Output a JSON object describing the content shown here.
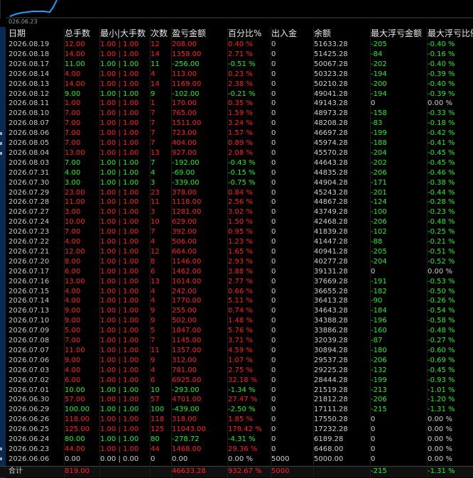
{
  "chart": {
    "date_label": "026.06.23",
    "line_color": "#1fa0ff"
  },
  "columns": [
    "日期",
    "总手数",
    "最小|大手数",
    "次数",
    "盈亏金额",
    "百分比%",
    "出入金",
    "余额",
    "最大浮亏金额",
    "最大浮亏比例"
  ],
  "rows": [
    {
      "date": "2026.08.19",
      "lots": "12.00",
      "minmax": "1.00 | 1.00",
      "count": "12",
      "pnl": "208.00",
      "pct": "0.40 %",
      "io": "0",
      "bal": "51633.28",
      "maxloss": "-205",
      "maxpct": "-0.40 %",
      "dir": "red"
    },
    {
      "date": "2026.08.18",
      "lots": "14.00",
      "minmax": "1.00 | 1.00",
      "count": "14",
      "pnl": "1358.00",
      "pct": "2.71 %",
      "io": "0",
      "bal": "51425.28",
      "maxloss": "-84",
      "maxpct": "-0.16 %",
      "dir": "red"
    },
    {
      "date": "2026.08.17",
      "lots": "11.00",
      "minmax": "1.00 | 1.00",
      "count": "11",
      "pnl": "-256.00",
      "pct": "-0.51 %",
      "io": "0",
      "bal": "50067.28",
      "maxloss": "-202",
      "maxpct": "-0.40 %",
      "dir": "green"
    },
    {
      "date": "2026.08.14",
      "lots": "4.00",
      "minmax": "1.00 | 1.00",
      "count": "4",
      "pnl": "113.00",
      "pct": "0.23 %",
      "io": "0",
      "bal": "50323.28",
      "maxloss": "-194",
      "maxpct": "-0.39 %",
      "dir": "red"
    },
    {
      "date": "2026.08.13",
      "lots": "14.00",
      "minmax": "1.00 | 1.00",
      "count": "14",
      "pnl": "1169.00",
      "pct": "2.38 %",
      "io": "0",
      "bal": "50210.28",
      "maxloss": "-200",
      "maxpct": "-0.40 %",
      "dir": "red"
    },
    {
      "date": "2026.08.12",
      "lots": "9.00",
      "minmax": "1.00 | 1.00",
      "count": "9",
      "pnl": "-102.00",
      "pct": "-0.21 %",
      "io": "0",
      "bal": "49041.28",
      "maxloss": "-194",
      "maxpct": "-0.39 %",
      "dir": "green"
    },
    {
      "date": "2026.08.11",
      "lots": "1.00",
      "minmax": "1.00 | 1.00",
      "count": "1",
      "pnl": "170.00",
      "pct": "0.35 %",
      "io": "0",
      "bal": "49143.28",
      "maxloss": "0",
      "maxpct": "0.00 %",
      "dir": "red"
    },
    {
      "date": "2026.08.10",
      "lots": "7.00",
      "minmax": "1.00 | 1.00",
      "count": "7",
      "pnl": "765.00",
      "pct": "1.59 %",
      "io": "0",
      "bal": "48973.28",
      "maxloss": "-158",
      "maxpct": "-0.33 %",
      "dir": "red"
    },
    {
      "date": "2026.08.07",
      "lots": "7.00",
      "minmax": "1.00 | 1.00",
      "count": "7",
      "pnl": "1511.00",
      "pct": "3.24 %",
      "io": "0",
      "bal": "48208.28",
      "maxloss": "-83",
      "maxpct": "-0.18 %",
      "dir": "red"
    },
    {
      "date": "2026.08.06",
      "lots": "7.00",
      "minmax": "1.00 | 1.00",
      "count": "7",
      "pnl": "723.00",
      "pct": "1.57 %",
      "io": "0",
      "bal": "46697.28",
      "maxloss": "-199",
      "maxpct": "-0.42 %",
      "dir": "red"
    },
    {
      "date": "2026.08.05",
      "lots": "7.00",
      "minmax": "1.00 | 1.00",
      "count": "7",
      "pnl": "404.00",
      "pct": "0.89 %",
      "io": "0",
      "bal": "45974.28",
      "maxloss": "-188",
      "maxpct": "-0.41 %",
      "dir": "red"
    },
    {
      "date": "2026.08.04",
      "lots": "13.00",
      "minmax": "1.00 | 1.00",
      "count": "13",
      "pnl": "927.00",
      "pct": "2.08 %",
      "io": "0",
      "bal": "45570.28",
      "maxloss": "-204",
      "maxpct": "-0.45 %",
      "dir": "red"
    },
    {
      "date": "2026.08.03",
      "lots": "7.00",
      "minmax": "1.00 | 1.00",
      "count": "7",
      "pnl": "-192.00",
      "pct": "-0.43 %",
      "io": "0",
      "bal": "44643.28",
      "maxloss": "-202",
      "maxpct": "-0.45 %",
      "dir": "green"
    },
    {
      "date": "2026.07.31",
      "lots": "4.00",
      "minmax": "1.00 | 1.00",
      "count": "4",
      "pnl": "-69.00",
      "pct": "-0.15 %",
      "io": "0",
      "bal": "44835.28",
      "maxloss": "-206",
      "maxpct": "-0.46 %",
      "dir": "green"
    },
    {
      "date": "2026.07.30",
      "lots": "3.00",
      "minmax": "1.00 | 1.00",
      "count": "3",
      "pnl": "-339.00",
      "pct": "-0.75 %",
      "io": "0",
      "bal": "44904.28",
      "maxloss": "-171",
      "maxpct": "-0.38 %",
      "dir": "green"
    },
    {
      "date": "2026.07.29",
      "lots": "23.00",
      "minmax": "1.00 | 1.00",
      "count": "23",
      "pnl": "378.00",
      "pct": "0.84 %",
      "io": "0",
      "bal": "45243.28",
      "maxloss": "-201",
      "maxpct": "-0.44 %",
      "dir": "red"
    },
    {
      "date": "2026.07.28",
      "lots": "11.00",
      "minmax": "1.00 | 1.00",
      "count": "11",
      "pnl": "1118.00",
      "pct": "2.56 %",
      "io": "0",
      "bal": "44867.28",
      "maxloss": "-124",
      "maxpct": "-0.28 %",
      "dir": "red"
    },
    {
      "date": "2026.07.27",
      "lots": "3.00",
      "minmax": "1.00 | 1.00",
      "count": "3",
      "pnl": "1281.00",
      "pct": "3.02 %",
      "io": "0",
      "bal": "43749.28",
      "maxloss": "-100",
      "maxpct": "-0.23 %",
      "dir": "red"
    },
    {
      "date": "2026.07.24",
      "lots": "10.00",
      "minmax": "1.00 | 1.00",
      "count": "10",
      "pnl": "629.00",
      "pct": "1.50 %",
      "io": "0",
      "bal": "42468.28",
      "maxloss": "-206",
      "maxpct": "-0.48 %",
      "dir": "red"
    },
    {
      "date": "2026.07.23",
      "lots": "7.00",
      "minmax": "1.00 | 1.00",
      "count": "7",
      "pnl": "392.00",
      "pct": "0.95 %",
      "io": "0",
      "bal": "41839.28",
      "maxloss": "-102",
      "maxpct": "-0.25 %",
      "dir": "red"
    },
    {
      "date": "2026.07.22",
      "lots": "4.00",
      "minmax": "1.00 | 1.00",
      "count": "4",
      "pnl": "506.00",
      "pct": "1.23 %",
      "io": "0",
      "bal": "41447.28",
      "maxloss": "-88",
      "maxpct": "-0.21 %",
      "dir": "red"
    },
    {
      "date": "2026.07.21",
      "lots": "12.00",
      "minmax": "1.00 | 1.00",
      "count": "12",
      "pnl": "664.00",
      "pct": "1.65 %",
      "io": "0",
      "bal": "40941.28",
      "maxloss": "-205",
      "maxpct": "-0.51 %",
      "dir": "red"
    },
    {
      "date": "2026.07.20",
      "lots": "8.00",
      "minmax": "1.00 | 1.00",
      "count": "8",
      "pnl": "1146.00",
      "pct": "2.93 %",
      "io": "0",
      "bal": "40277.28",
      "maxloss": "-204",
      "maxpct": "-0.52 %",
      "dir": "red"
    },
    {
      "date": "2026.07.17",
      "lots": "6.00",
      "minmax": "1.00 | 1.00",
      "count": "6",
      "pnl": "1462.00",
      "pct": "3.88 %",
      "io": "0",
      "bal": "39131.28",
      "maxloss": "0",
      "maxpct": "0.00 %",
      "dir": "red"
    },
    {
      "date": "2026.07.16",
      "lots": "13.00",
      "minmax": "1.00 | 1.00",
      "count": "13",
      "pnl": "1014.00",
      "pct": "2.77 %",
      "io": "0",
      "bal": "37669.28",
      "maxloss": "-191",
      "maxpct": "-0.53 %",
      "dir": "red"
    },
    {
      "date": "2026.07.15",
      "lots": "4.00",
      "minmax": "1.00 | 1.00",
      "count": "4",
      "pnl": "242.00",
      "pct": "0.66 %",
      "io": "0",
      "bal": "36655.28",
      "maxloss": "-182",
      "maxpct": "-0.50 %",
      "dir": "red"
    },
    {
      "date": "2026.07.14",
      "lots": "4.00",
      "minmax": "1.00 | 1.00",
      "count": "4",
      "pnl": "1770.00",
      "pct": "5.11 %",
      "io": "0",
      "bal": "36413.28",
      "maxloss": "-90",
      "maxpct": "-0.26 %",
      "dir": "red"
    },
    {
      "date": "2026.07.13",
      "lots": "9.00",
      "minmax": "1.00 | 1.00",
      "count": "9",
      "pnl": "255.00",
      "pct": "0.74 %",
      "io": "0",
      "bal": "34643.28",
      "maxloss": "-184",
      "maxpct": "-0.54 %",
      "dir": "red"
    },
    {
      "date": "2026.07.10",
      "lots": "9.00",
      "minmax": "1.00 | 1.00",
      "count": "9",
      "pnl": "502.00",
      "pct": "1.48 %",
      "io": "0",
      "bal": "34388.28",
      "maxloss": "-196",
      "maxpct": "-0.58 %",
      "dir": "red"
    },
    {
      "date": "2026.07.09",
      "lots": "5.00",
      "minmax": "1.00 | 1.00",
      "count": "5",
      "pnl": "1847.00",
      "pct": "5.76 %",
      "io": "0",
      "bal": "33886.28",
      "maxloss": "-160",
      "maxpct": "-0.48 %",
      "dir": "red"
    },
    {
      "date": "2026.07.08",
      "lots": "7.00",
      "minmax": "1.00 | 1.00",
      "count": "7",
      "pnl": "1145.00",
      "pct": "3.71 %",
      "io": "0",
      "bal": "32039.28",
      "maxloss": "-87",
      "maxpct": "-0.27 %",
      "dir": "red"
    },
    {
      "date": "2026.07.07",
      "lots": "11.00",
      "minmax": "1.00 | 1.00",
      "count": "11",
      "pnl": "1357.00",
      "pct": "4.59 %",
      "io": "0",
      "bal": "30894.28",
      "maxloss": "-180",
      "maxpct": "-0.60 %",
      "dir": "red"
    },
    {
      "date": "2026.07.06",
      "lots": "9.00",
      "minmax": "1.00 | 1.00",
      "count": "9",
      "pnl": "312.00",
      "pct": "1.07 %",
      "io": "0",
      "bal": "29537.28",
      "maxloss": "-206",
      "maxpct": "-0.69 %",
      "dir": "red"
    },
    {
      "date": "2026.07.03",
      "lots": "4.00",
      "minmax": "1.00 | 1.00",
      "count": "4",
      "pnl": "781.00",
      "pct": "2.75 %",
      "io": "0",
      "bal": "29225.28",
      "maxloss": "-132",
      "maxpct": "-0.45 %",
      "dir": "red"
    },
    {
      "date": "2026.07.02",
      "lots": "6.00",
      "minmax": "1.00 | 1.00",
      "count": "6",
      "pnl": "6925.00",
      "pct": "32.18 %",
      "io": "0",
      "bal": "28444.28",
      "maxloss": "-199",
      "maxpct": "-0.93 %",
      "dir": "red"
    },
    {
      "date": "2026.07.01",
      "lots": "10.00",
      "minmax": "1.00 | 1.00",
      "count": "10",
      "pnl": "-293.00",
      "pct": "-1.34 %",
      "io": "0",
      "bal": "21519.28",
      "maxloss": "-213",
      "maxpct": "-1.01 %",
      "dir": "green"
    },
    {
      "date": "2026.06.30",
      "lots": "57.00",
      "minmax": "1.00 | 1.00",
      "count": "57",
      "pnl": "4701.00",
      "pct": "27.47 %",
      "io": "0",
      "bal": "21812.28",
      "maxloss": "-206",
      "maxpct": "-1.20 %",
      "dir": "red"
    },
    {
      "date": "2026.06.29",
      "lots": "100.00",
      "minmax": "1.00 | 1.00",
      "count": "100",
      "pnl": "-439.00",
      "pct": "-2.50 %",
      "io": "0",
      "bal": "17111.28",
      "maxloss": "-215",
      "maxpct": "-1.31 %",
      "dir": "green"
    },
    {
      "date": "2026.06.26",
      "lots": "118.00",
      "minmax": "1.00 | 1.00",
      "count": "118",
      "pnl": "318.00",
      "pct": "1.85 %",
      "io": "0",
      "bal": "17550.28",
      "maxloss": "0",
      "maxpct": "0.00 %",
      "dir": "red"
    },
    {
      "date": "2026.06.25",
      "lots": "125.00",
      "minmax": "1.00 | 1.00",
      "count": "125",
      "pnl": "11043.00",
      "pct": "178.42 %",
      "io": "0",
      "bal": "17232.28",
      "maxloss": "0",
      "maxpct": "0.00 %",
      "dir": "red"
    },
    {
      "date": "2026.06.24",
      "lots": "80.00",
      "minmax": "1.00 | 1.00",
      "count": "80",
      "pnl": "-278.72",
      "pct": "-4.31 %",
      "io": "0",
      "bal": "6189.28",
      "maxloss": "0",
      "maxpct": "0.00 %",
      "dir": "green"
    },
    {
      "date": "2026.06.23",
      "lots": "44.00",
      "minmax": "1.00 | 1.00",
      "count": "44",
      "pnl": "1468.00",
      "pct": "29.36 %",
      "io": "0",
      "bal": "6468.00",
      "maxloss": "0",
      "maxpct": "0.00 %",
      "dir": "red"
    },
    {
      "date": "2026.06.06",
      "lots": "0.00",
      "minmax": "0.00 | 0.00",
      "count": "0",
      "pnl": "0.00",
      "pct": "0.00 %",
      "io": "5000",
      "bal": "5000.00",
      "maxloss": "0",
      "maxpct": "0.00 %",
      "dir": "grey"
    }
  ],
  "total": {
    "label": "合计",
    "lots": "819.00",
    "pnl": "46633.28",
    "pct": "932.67 %",
    "io": "5000",
    "maxloss": "-215",
    "maxpct": "-1.31 %"
  },
  "colors": {
    "up": "#ff2020",
    "down": "#22ee22",
    "neutral": "#d0d0d0",
    "background": "#000000"
  }
}
